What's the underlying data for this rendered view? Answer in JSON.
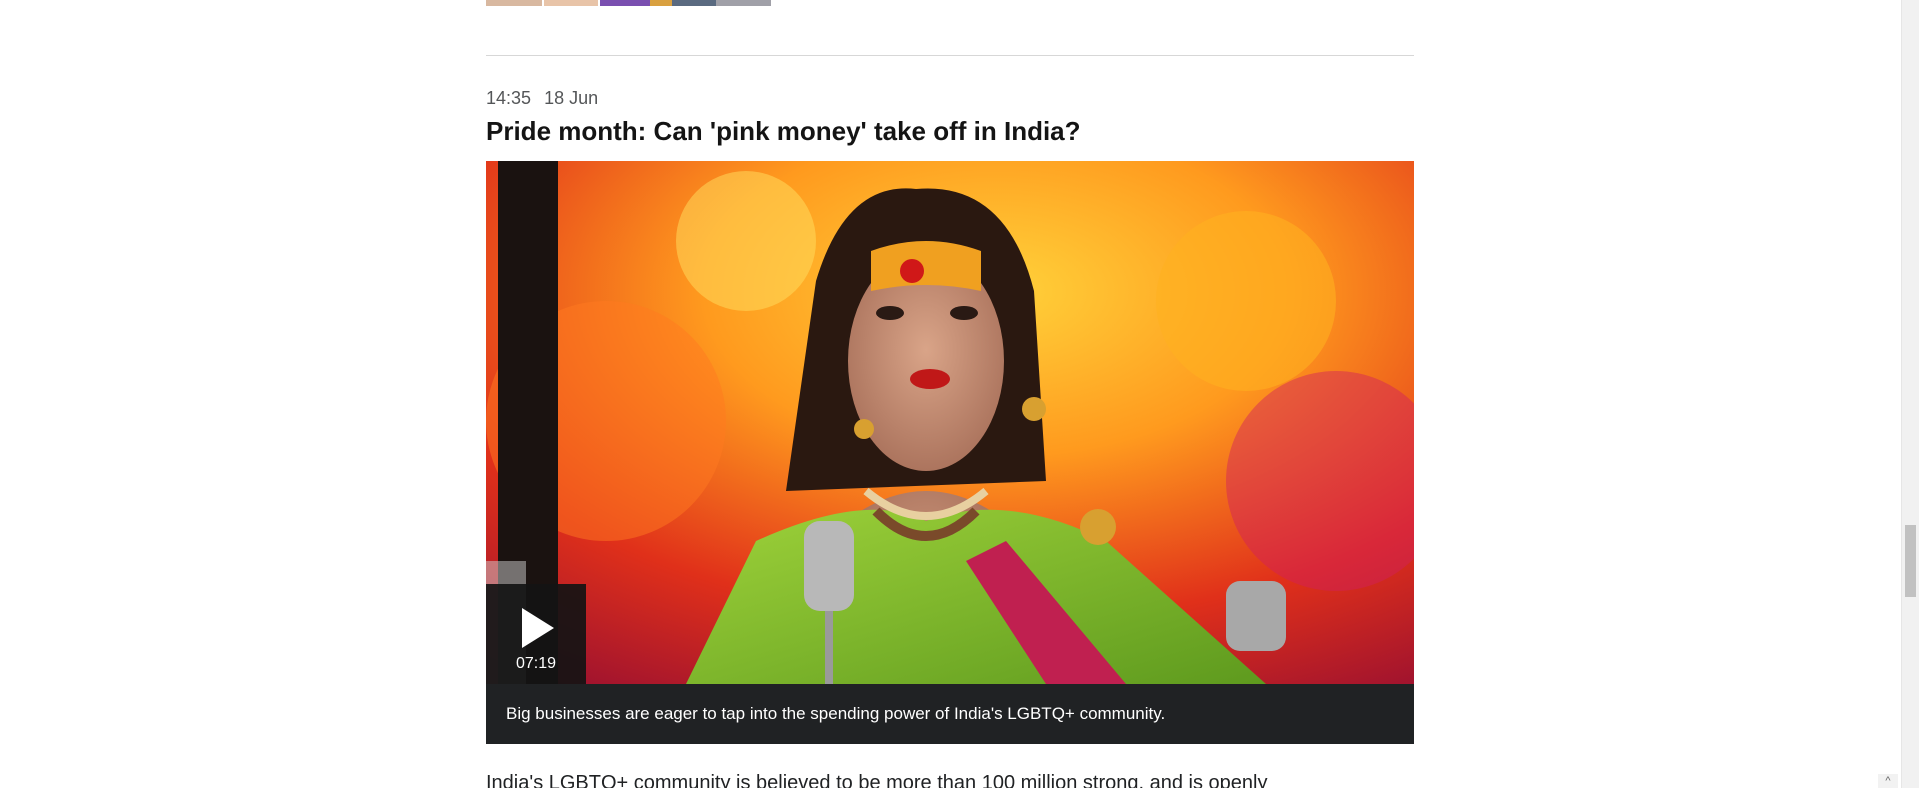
{
  "entry": {
    "time": "14:35",
    "date": "18 Jun",
    "headline": "Pride month: Can 'pink money' take off in India?"
  },
  "video": {
    "duration": "07:19",
    "caption": "Big businesses are eager to tap into the spending power of India's LGBTQ+ community."
  },
  "body": {
    "first_line": "India's LGBTQ+ community is believed to be more than 100 million strong, and is openly"
  },
  "icons": {
    "play": "play-icon",
    "back_to_top": "chevron-up-icon"
  },
  "colors": {
    "caption_bg": "#202224",
    "play_bg": "#141414",
    "headline": "#141414",
    "meta": "#545658"
  }
}
